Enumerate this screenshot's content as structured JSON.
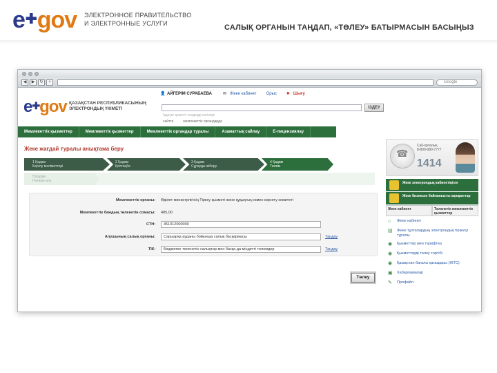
{
  "slide": {
    "logo_e": "e",
    "logo_gov": "gov",
    "subtitle_line1": "ЭЛЕКТРОННОЕ ПРАВИТЕЛЬСТВО",
    "subtitle_line2": "И ЭЛЕКТРОННЫЕ УСЛУГИ",
    "title": "САЛЫҚ ОРГАНЫН ТАҢДАП, «ТӨЛЕУ» БАТЫРМАСЫН БАСЫҢЫЗ"
  },
  "browser": {
    "search_placeholder": "Google"
  },
  "site": {
    "logo_e": "e",
    "logo_gov": "gov",
    "logo_sub_line1": "ҚАЗАҚСТАН РЕСПУБЛИКАСЫНЫҢ",
    "logo_sub_line2": "ЭЛЕКТРОНДЫҚ ҮКІМЕТІ",
    "user_name": "АЙГЕРІМ СУРАБАЕВА",
    "user_link": "Жеке кабинет",
    "lang_link": "Орыс",
    "exit_link": "Шығу",
    "search_button": "ІЗДЕУ",
    "search_hint": "Іздеуге қажетті сөздерді енгізіңіз",
    "search_options": [
      "сайтта",
      "мемлекеттік органдарда"
    ]
  },
  "nav": {
    "items": [
      "Мемлекеттік қызметтер",
      "Мемлекеттік қызметтер",
      "Мемлекеттік органдар туралы",
      "Азаматтық сайлау",
      "Е-лицензиялау"
    ]
  },
  "content": {
    "heading": "Жеке жағдай туралы анықтама беру",
    "steps": [
      {
        "num": "1 Қадам",
        "label": "Берілу мәліметтері"
      },
      {
        "num": "2 Қадам",
        "label": "Қолтаңба"
      },
      {
        "num": "3 Қадам",
        "label": "Сұрауды жіберу"
      },
      {
        "num": "4 Қадам",
        "label": "Төлем"
      }
    ],
    "step5": {
      "num": "5 Қадам",
      "label": "Нәтиже алу"
    },
    "form": {
      "row1_label": "Мемлекеттік органы:",
      "row1_value": "Әділет министрлігінің Тіркеу қызметі және құқықтық көмек көрсету комитеті",
      "row2_label": "Мемлекеттік баждың төленетін сомасы:",
      "row2_value": "485,00",
      "row3_label": "СТН:",
      "row3_value": "451012000000",
      "row4_label": "Алушының салық органы:",
      "row4_value": "Сарыарқа ауданы бойынша салық басқармасы",
      "row4_link": "Таңдау",
      "row5_label": "ТІК:",
      "row5_value": "Бюджетке төленетін салықтар мен басқа да міндетті төлемдер",
      "row5_link": "Таңдау"
    },
    "pay_button": "Төлеу"
  },
  "sidebar": {
    "cc_line1": "Call-орталық",
    "cc_line2": "8-800-080-7777",
    "cc_number": "1414",
    "panel1": "Жеке электрондық кабинетіңізге",
    "panel2": "Жеке бизнеске байланысты ақпараттар",
    "sub1": "Жеке кабинет",
    "sub2": "Төленетін мемлекеттік қызметтер",
    "items": [
      "Жеке кабинет",
      "Жеке тұлғалардың электрондық тіркелуі туралы",
      "Қызметтер мен тарифтер",
      "Қызметтерді төлеу тәртібі",
      "Қазақстан бағалы қағаздары (ЖТС)",
      "Хабарламалар",
      "Профайл"
    ]
  },
  "colors": {
    "brand_blue": "#2b3a8a",
    "brand_orange": "#e07a14",
    "nav_green": "#2c6e3c",
    "heading_red": "#b03a2e"
  }
}
